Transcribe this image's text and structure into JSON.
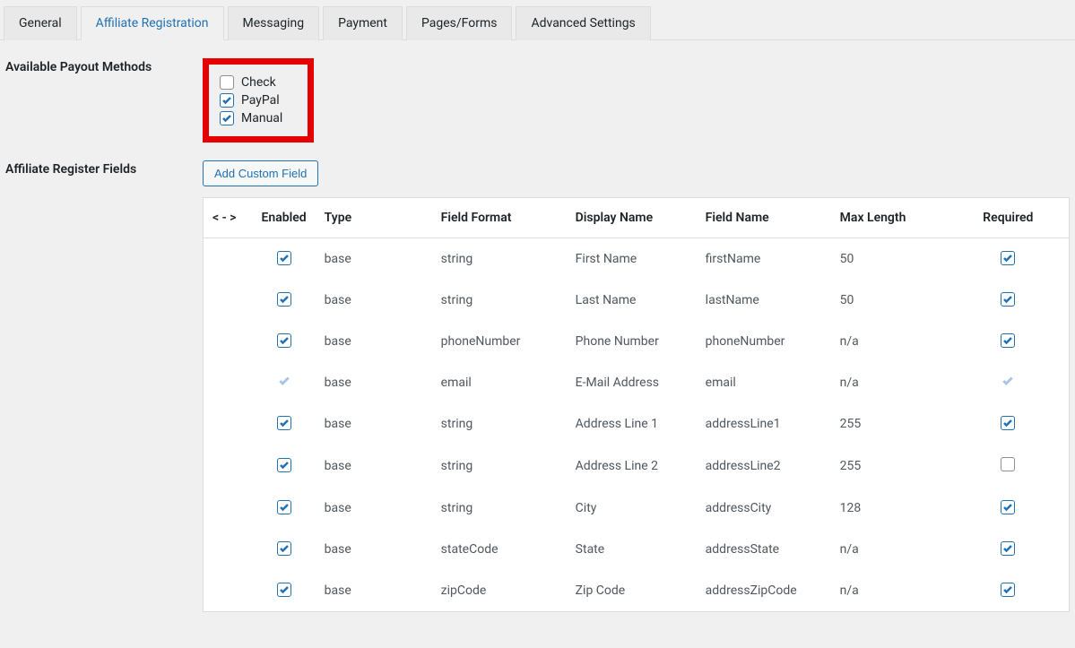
{
  "tabs": {
    "general": "General",
    "affiliate_registration": "Affiliate Registration",
    "messaging": "Messaging",
    "payment": "Payment",
    "pages_forms": "Pages/Forms",
    "advanced": "Advanced Settings"
  },
  "labels": {
    "payout_methods": "Available Payout Methods",
    "register_fields": "Affiliate Register Fields"
  },
  "payout_methods": {
    "check": {
      "label": "Check",
      "checked": false
    },
    "paypal": {
      "label": "PayPal",
      "checked": true
    },
    "manual": {
      "label": "Manual",
      "checked": true
    }
  },
  "buttons": {
    "add_custom_field": "Add Custom Field"
  },
  "table": {
    "headers": {
      "reorder": "< - >",
      "enabled": "Enabled",
      "type": "Type",
      "field_format": "Field Format",
      "display_name": "Display Name",
      "field_name": "Field Name",
      "max_length": "Max Length",
      "required": "Required"
    },
    "rows": [
      {
        "enabled": true,
        "enabled_locked": false,
        "type": "base",
        "field_format": "string",
        "display_name": "First Name",
        "field_name": "firstName",
        "max_length": "50",
        "required": true,
        "required_locked": false
      },
      {
        "enabled": true,
        "enabled_locked": false,
        "type": "base",
        "field_format": "string",
        "display_name": "Last Name",
        "field_name": "lastName",
        "max_length": "50",
        "required": true,
        "required_locked": false
      },
      {
        "enabled": true,
        "enabled_locked": false,
        "type": "base",
        "field_format": "phoneNumber",
        "display_name": "Phone Number",
        "field_name": "phoneNumber",
        "max_length": "n/a",
        "required": true,
        "required_locked": false
      },
      {
        "enabled": true,
        "enabled_locked": true,
        "type": "base",
        "field_format": "email",
        "display_name": "E-Mail Address",
        "field_name": "email",
        "max_length": "n/a",
        "required": true,
        "required_locked": true
      },
      {
        "enabled": true,
        "enabled_locked": false,
        "type": "base",
        "field_format": "string",
        "display_name": "Address Line 1",
        "field_name": "addressLine1",
        "max_length": "255",
        "required": true,
        "required_locked": false
      },
      {
        "enabled": true,
        "enabled_locked": false,
        "type": "base",
        "field_format": "string",
        "display_name": "Address Line 2",
        "field_name": "addressLine2",
        "max_length": "255",
        "required": false,
        "required_locked": false
      },
      {
        "enabled": true,
        "enabled_locked": false,
        "type": "base",
        "field_format": "string",
        "display_name": "City",
        "field_name": "addressCity",
        "max_length": "128",
        "required": true,
        "required_locked": false
      },
      {
        "enabled": true,
        "enabled_locked": false,
        "type": "base",
        "field_format": "stateCode",
        "display_name": "State",
        "field_name": "addressState",
        "max_length": "n/a",
        "required": true,
        "required_locked": false
      },
      {
        "enabled": true,
        "enabled_locked": false,
        "type": "base",
        "field_format": "zipCode",
        "display_name": "Zip Code",
        "field_name": "addressZipCode",
        "max_length": "n/a",
        "required": true,
        "required_locked": false
      }
    ]
  }
}
